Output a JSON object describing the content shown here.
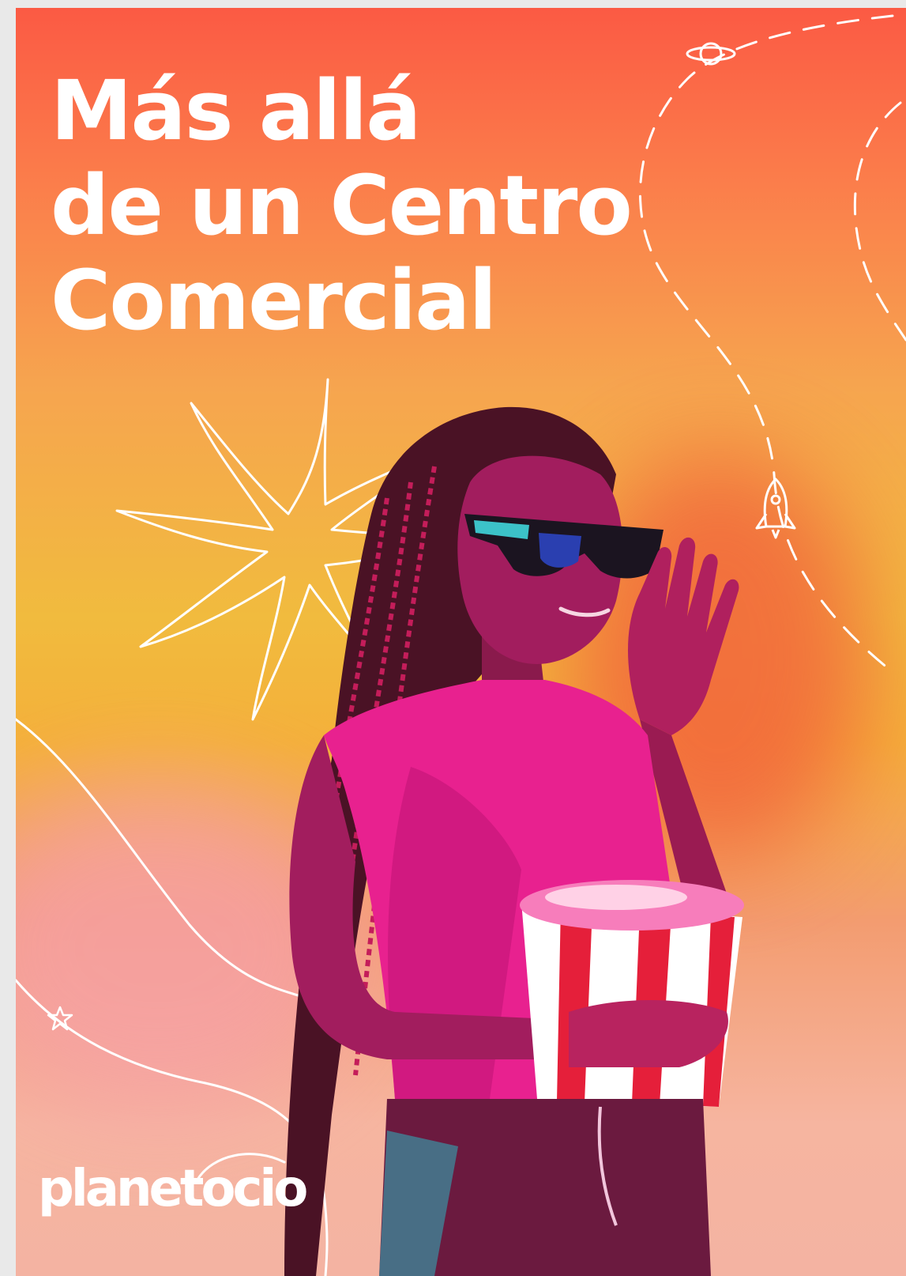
{
  "headline": {
    "line1": "Más allá",
    "line2": "de un Centro",
    "line3": "Comercial"
  },
  "brand": {
    "logo_text": "planetocio"
  },
  "colors": {
    "top": "#fb5a44",
    "middle": "#f1bb3e",
    "bottom": "#f4b3a2",
    "shirt": "#e8218f",
    "text": "#ffffff"
  },
  "icons": [
    "planet-icon",
    "rocket-icon",
    "sparkle-star-icon",
    "small-star-icon"
  ]
}
